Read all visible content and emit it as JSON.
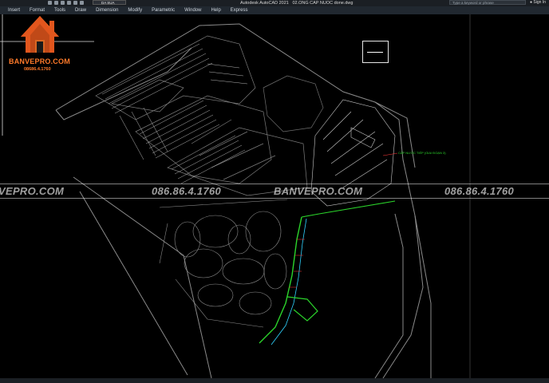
{
  "window": {
    "app_title": "Autodesk AutoCAD 2021",
    "file_name": "02.ONG CAP NUOC done.dwg",
    "search_placeholder": "Type a keyword or phrase",
    "signin": "Sign In"
  },
  "quick_access": {
    "layer_value": "DA SUA"
  },
  "menu": [
    "Insert",
    "Format",
    "Tools",
    "Draw",
    "Dimension",
    "Modify",
    "Parametric",
    "Window",
    "Help",
    "Express"
  ],
  "watermark": {
    "brand": "BANVEPRO.COM",
    "phone_small": "08686.4.1760",
    "band_texts": [
      "VEPRO.COM",
      "086.86.4.1760",
      "BANVEPRO.COM",
      "086.86.4.1760"
    ]
  },
  "drawing": {
    "annotation": "CẤP NƯỚC TIẾP (GIAI ĐOẠN 3)"
  },
  "colors": {
    "accent_orange": "#ff7a2a",
    "pipe_green": "#2bd42b",
    "pipe_cyan": "#2fd3ff",
    "linework": "#9a9a9a"
  },
  "icons": [
    "house-logo-icon",
    "crosshair-icon",
    "search-icon",
    "user-icon"
  ]
}
